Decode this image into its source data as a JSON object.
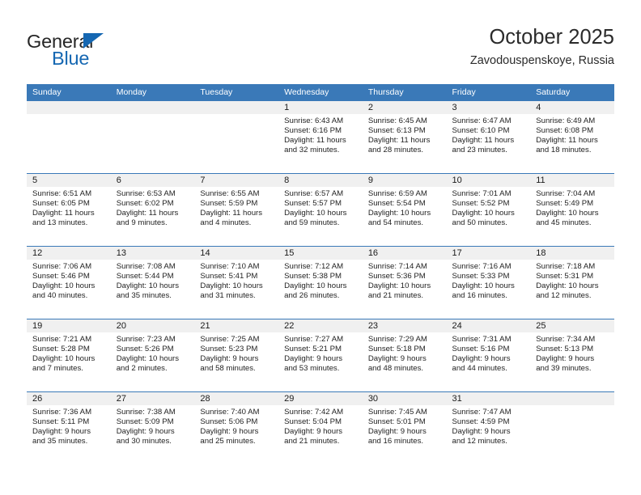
{
  "brand": {
    "name_part1": "General",
    "name_part2": "Blue",
    "accent_color": "#1567b2"
  },
  "header": {
    "title": "October 2025",
    "subtitle": "Zavodouspenskoye, Russia"
  },
  "theme": {
    "header_row_bg": "#3a79b8",
    "daynum_bg": "#f0f0f0",
    "cell_border": "#3a79b8",
    "text_color": "#232323"
  },
  "weekdays": [
    "Sunday",
    "Monday",
    "Tuesday",
    "Wednesday",
    "Thursday",
    "Friday",
    "Saturday"
  ],
  "labels": {
    "sunrise_prefix": "Sunrise:",
    "sunset_prefix": "Sunset:",
    "daylight_prefix": "Daylight:"
  },
  "weeks": [
    [
      {
        "day": "",
        "blank": true
      },
      {
        "day": "",
        "blank": true
      },
      {
        "day": "",
        "blank": true
      },
      {
        "day": "1",
        "sunrise": "Sunrise: 6:43 AM",
        "sunset": "Sunset: 6:16 PM",
        "daylight1": "Daylight: 11 hours",
        "daylight2": "and 32 minutes."
      },
      {
        "day": "2",
        "sunrise": "Sunrise: 6:45 AM",
        "sunset": "Sunset: 6:13 PM",
        "daylight1": "Daylight: 11 hours",
        "daylight2": "and 28 minutes."
      },
      {
        "day": "3",
        "sunrise": "Sunrise: 6:47 AM",
        "sunset": "Sunset: 6:10 PM",
        "daylight1": "Daylight: 11 hours",
        "daylight2": "and 23 minutes."
      },
      {
        "day": "4",
        "sunrise": "Sunrise: 6:49 AM",
        "sunset": "Sunset: 6:08 PM",
        "daylight1": "Daylight: 11 hours",
        "daylight2": "and 18 minutes."
      }
    ],
    [
      {
        "day": "5",
        "sunrise": "Sunrise: 6:51 AM",
        "sunset": "Sunset: 6:05 PM",
        "daylight1": "Daylight: 11 hours",
        "daylight2": "and 13 minutes."
      },
      {
        "day": "6",
        "sunrise": "Sunrise: 6:53 AM",
        "sunset": "Sunset: 6:02 PM",
        "daylight1": "Daylight: 11 hours",
        "daylight2": "and 9 minutes."
      },
      {
        "day": "7",
        "sunrise": "Sunrise: 6:55 AM",
        "sunset": "Sunset: 5:59 PM",
        "daylight1": "Daylight: 11 hours",
        "daylight2": "and 4 minutes."
      },
      {
        "day": "8",
        "sunrise": "Sunrise: 6:57 AM",
        "sunset": "Sunset: 5:57 PM",
        "daylight1": "Daylight: 10 hours",
        "daylight2": "and 59 minutes."
      },
      {
        "day": "9",
        "sunrise": "Sunrise: 6:59 AM",
        "sunset": "Sunset: 5:54 PM",
        "daylight1": "Daylight: 10 hours",
        "daylight2": "and 54 minutes."
      },
      {
        "day": "10",
        "sunrise": "Sunrise: 7:01 AM",
        "sunset": "Sunset: 5:52 PM",
        "daylight1": "Daylight: 10 hours",
        "daylight2": "and 50 minutes."
      },
      {
        "day": "11",
        "sunrise": "Sunrise: 7:04 AM",
        "sunset": "Sunset: 5:49 PM",
        "daylight1": "Daylight: 10 hours",
        "daylight2": "and 45 minutes."
      }
    ],
    [
      {
        "day": "12",
        "sunrise": "Sunrise: 7:06 AM",
        "sunset": "Sunset: 5:46 PM",
        "daylight1": "Daylight: 10 hours",
        "daylight2": "and 40 minutes."
      },
      {
        "day": "13",
        "sunrise": "Sunrise: 7:08 AM",
        "sunset": "Sunset: 5:44 PM",
        "daylight1": "Daylight: 10 hours",
        "daylight2": "and 35 minutes."
      },
      {
        "day": "14",
        "sunrise": "Sunrise: 7:10 AM",
        "sunset": "Sunset: 5:41 PM",
        "daylight1": "Daylight: 10 hours",
        "daylight2": "and 31 minutes."
      },
      {
        "day": "15",
        "sunrise": "Sunrise: 7:12 AM",
        "sunset": "Sunset: 5:38 PM",
        "daylight1": "Daylight: 10 hours",
        "daylight2": "and 26 minutes."
      },
      {
        "day": "16",
        "sunrise": "Sunrise: 7:14 AM",
        "sunset": "Sunset: 5:36 PM",
        "daylight1": "Daylight: 10 hours",
        "daylight2": "and 21 minutes."
      },
      {
        "day": "17",
        "sunrise": "Sunrise: 7:16 AM",
        "sunset": "Sunset: 5:33 PM",
        "daylight1": "Daylight: 10 hours",
        "daylight2": "and 16 minutes."
      },
      {
        "day": "18",
        "sunrise": "Sunrise: 7:18 AM",
        "sunset": "Sunset: 5:31 PM",
        "daylight1": "Daylight: 10 hours",
        "daylight2": "and 12 minutes."
      }
    ],
    [
      {
        "day": "19",
        "sunrise": "Sunrise: 7:21 AM",
        "sunset": "Sunset: 5:28 PM",
        "daylight1": "Daylight: 10 hours",
        "daylight2": "and 7 minutes."
      },
      {
        "day": "20",
        "sunrise": "Sunrise: 7:23 AM",
        "sunset": "Sunset: 5:26 PM",
        "daylight1": "Daylight: 10 hours",
        "daylight2": "and 2 minutes."
      },
      {
        "day": "21",
        "sunrise": "Sunrise: 7:25 AM",
        "sunset": "Sunset: 5:23 PM",
        "daylight1": "Daylight: 9 hours",
        "daylight2": "and 58 minutes."
      },
      {
        "day": "22",
        "sunrise": "Sunrise: 7:27 AM",
        "sunset": "Sunset: 5:21 PM",
        "daylight1": "Daylight: 9 hours",
        "daylight2": "and 53 minutes."
      },
      {
        "day": "23",
        "sunrise": "Sunrise: 7:29 AM",
        "sunset": "Sunset: 5:18 PM",
        "daylight1": "Daylight: 9 hours",
        "daylight2": "and 48 minutes."
      },
      {
        "day": "24",
        "sunrise": "Sunrise: 7:31 AM",
        "sunset": "Sunset: 5:16 PM",
        "daylight1": "Daylight: 9 hours",
        "daylight2": "and 44 minutes."
      },
      {
        "day": "25",
        "sunrise": "Sunrise: 7:34 AM",
        "sunset": "Sunset: 5:13 PM",
        "daylight1": "Daylight: 9 hours",
        "daylight2": "and 39 minutes."
      }
    ],
    [
      {
        "day": "26",
        "sunrise": "Sunrise: 7:36 AM",
        "sunset": "Sunset: 5:11 PM",
        "daylight1": "Daylight: 9 hours",
        "daylight2": "and 35 minutes."
      },
      {
        "day": "27",
        "sunrise": "Sunrise: 7:38 AM",
        "sunset": "Sunset: 5:09 PM",
        "daylight1": "Daylight: 9 hours",
        "daylight2": "and 30 minutes."
      },
      {
        "day": "28",
        "sunrise": "Sunrise: 7:40 AM",
        "sunset": "Sunset: 5:06 PM",
        "daylight1": "Daylight: 9 hours",
        "daylight2": "and 25 minutes."
      },
      {
        "day": "29",
        "sunrise": "Sunrise: 7:42 AM",
        "sunset": "Sunset: 5:04 PM",
        "daylight1": "Daylight: 9 hours",
        "daylight2": "and 21 minutes."
      },
      {
        "day": "30",
        "sunrise": "Sunrise: 7:45 AM",
        "sunset": "Sunset: 5:01 PM",
        "daylight1": "Daylight: 9 hours",
        "daylight2": "and 16 minutes."
      },
      {
        "day": "31",
        "sunrise": "Sunrise: 7:47 AM",
        "sunset": "Sunset: 4:59 PM",
        "daylight1": "Daylight: 9 hours",
        "daylight2": "and 12 minutes."
      },
      {
        "day": "",
        "blank": true
      }
    ]
  ]
}
